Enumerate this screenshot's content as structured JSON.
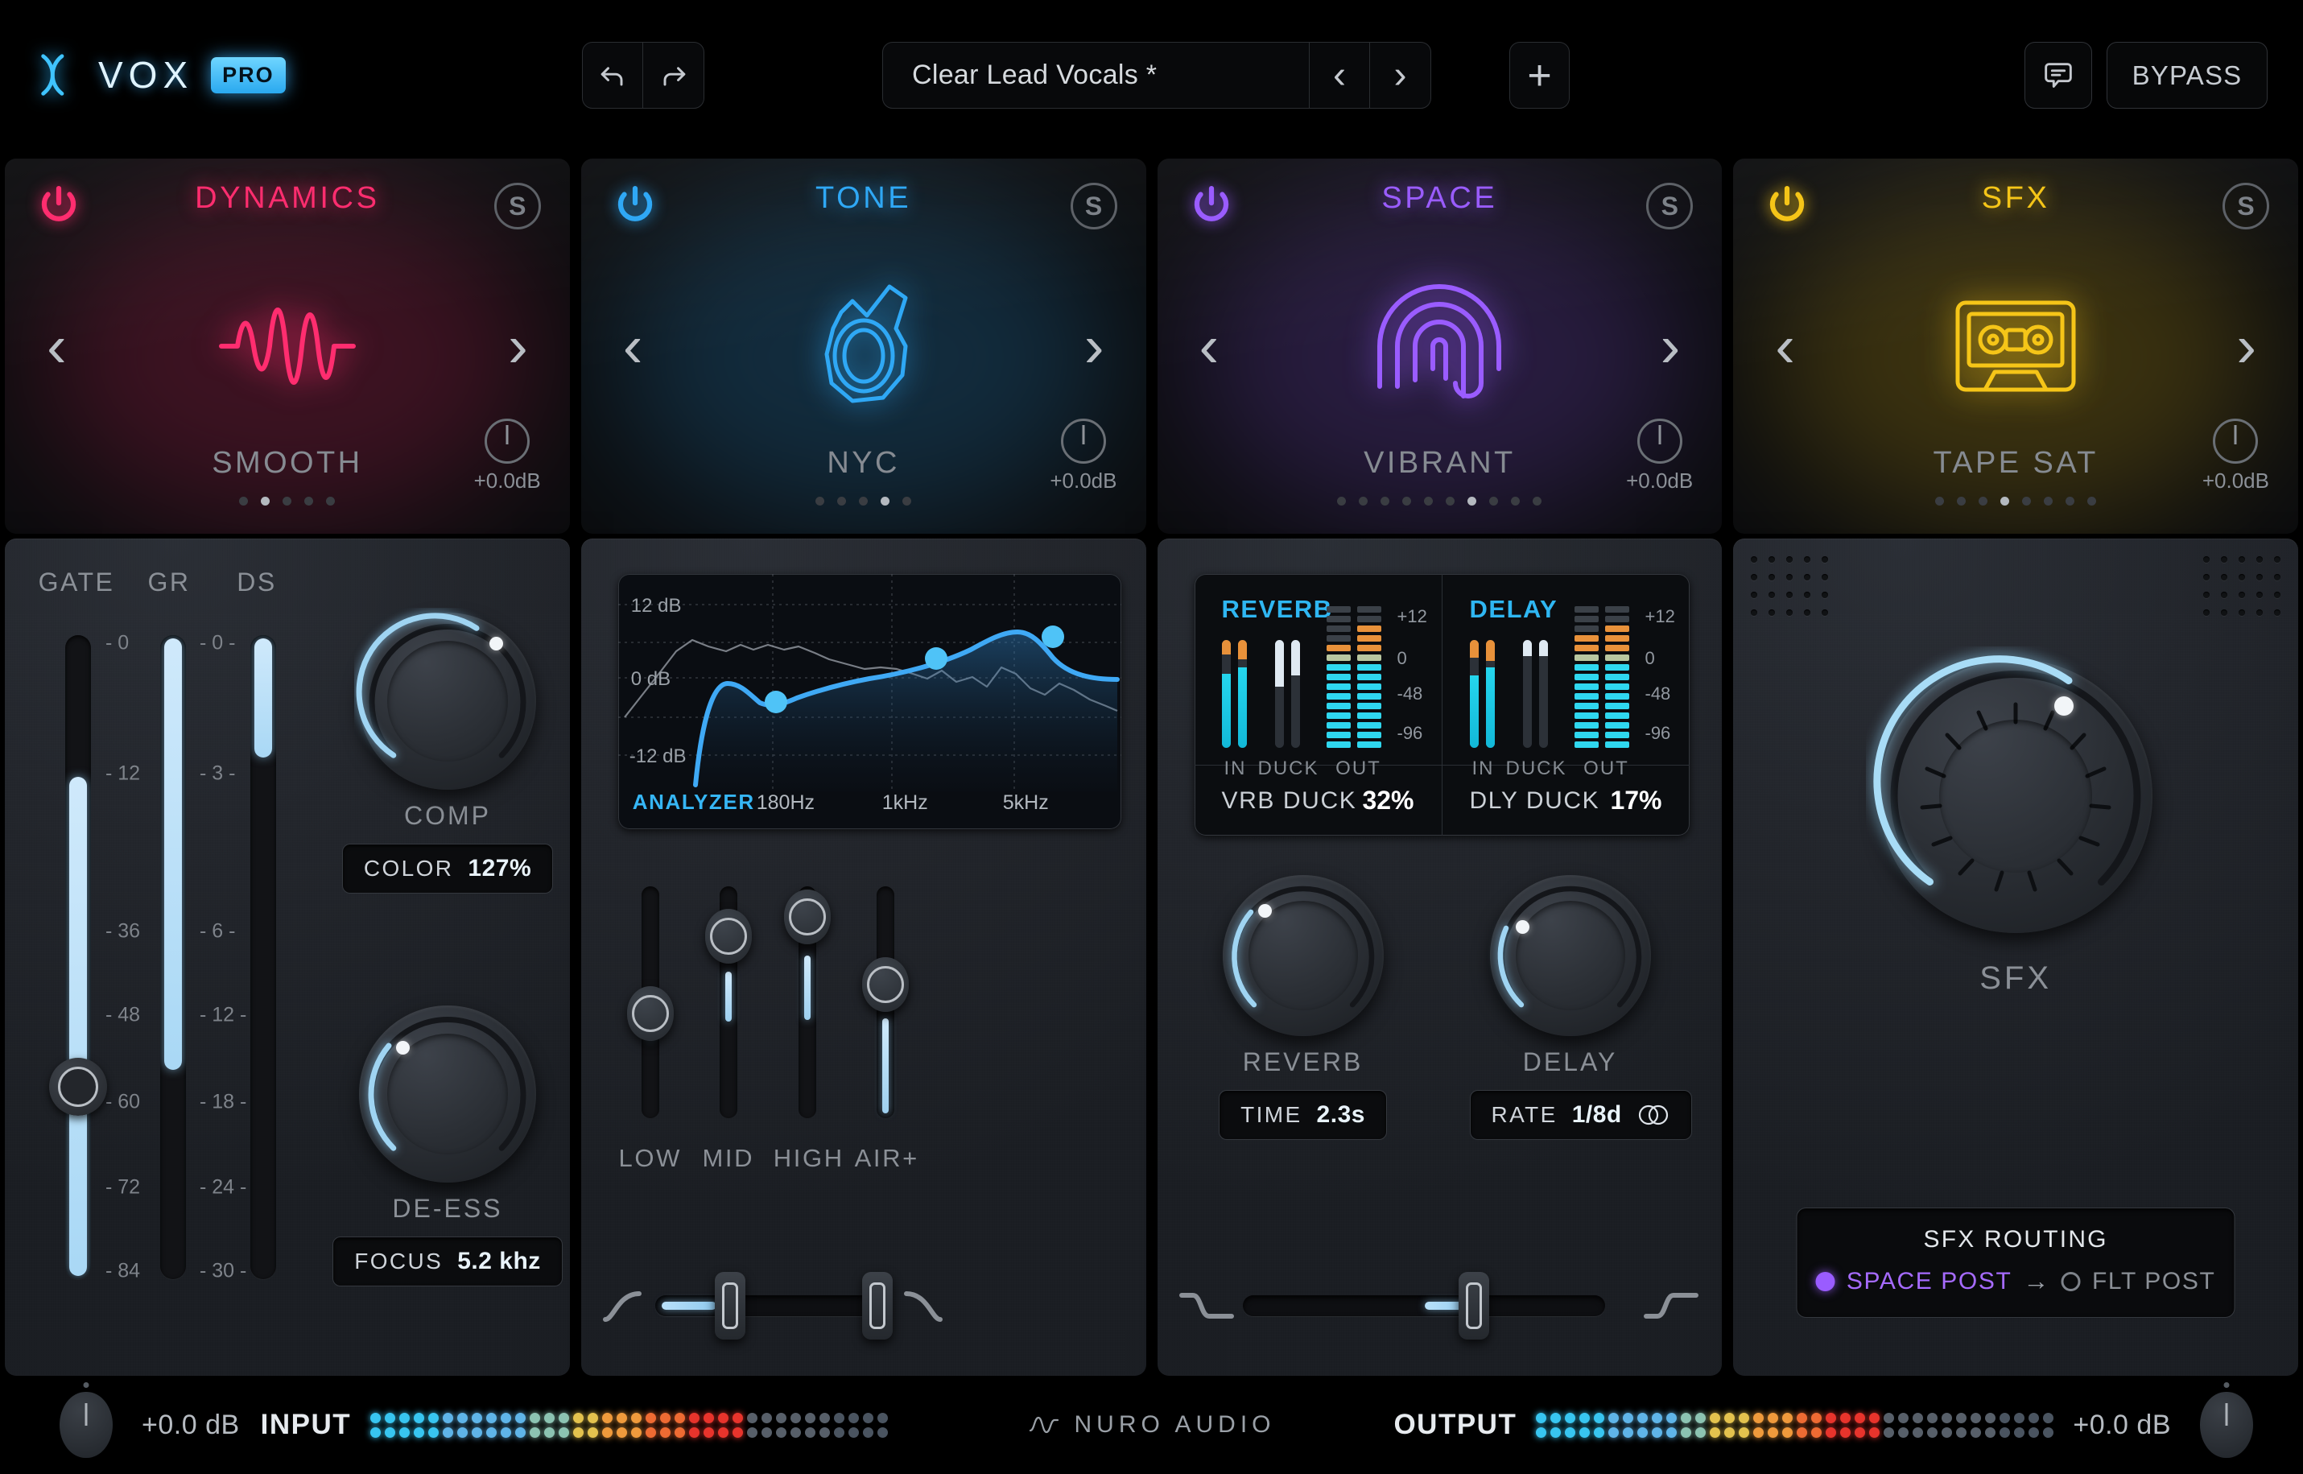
{
  "app": {
    "name": "VOX",
    "badge": "PRO",
    "brand": "NURO AUDIO"
  },
  "toolbar": {
    "undo_icon": "undo-icon",
    "redo_icon": "redo-icon",
    "preset_name": "Clear Lead Vocals *",
    "prev_label": "‹",
    "next_label": "›",
    "add_label": "+",
    "comment_icon": "comment-icon",
    "bypass_label": "BYPASS"
  },
  "modules": [
    {
      "title": "DYNAMICS",
      "color": "#ff2d6f",
      "preset": "SMOOTH",
      "icon": "waveform-icon",
      "solo_label": "S",
      "trim": "+0.0dB",
      "dots": 5,
      "active_dot": 1
    },
    {
      "title": "TONE",
      "color": "#2fa8f5",
      "preset": "NYC",
      "icon": "microphone-icon",
      "solo_label": "S",
      "trim": "+0.0dB",
      "dots": 5,
      "active_dot": 3
    },
    {
      "title": "SPACE",
      "color": "#9a5cff",
      "preset": "VIBRANT",
      "icon": "fingerprint-icon",
      "solo_label": "S",
      "trim": "+0.0dB",
      "dots": 10,
      "active_dot": 6
    },
    {
      "title": "SFX",
      "color": "#f5c518",
      "preset": "TAPE SAT",
      "icon": "cassette-icon",
      "solo_label": "S",
      "trim": "+0.0dB",
      "dots": 8,
      "active_dot": 3
    }
  ],
  "dynamics": {
    "meters": [
      {
        "label": "GATE",
        "ticks": [
          "- 0",
          "- 12",
          "- 36",
          "- 48",
          "- 60",
          "- 72",
          "- 84"
        ],
        "value_pct": 78,
        "handle_pct": 72
      },
      {
        "label": "GR",
        "ticks": [
          "- 0 -",
          "- 3 -",
          "- 6 -",
          "- 12 -",
          "- 18 -",
          "- 24 -",
          "- 30 -"
        ],
        "value_pct": 68
      },
      {
        "label": "DS",
        "ticks": [],
        "value_pct": 22
      }
    ],
    "comp": {
      "label": "COMP",
      "badge_key": "COLOR",
      "badge_value": "127%",
      "value_pct": 72
    },
    "deess": {
      "label": "DE-ESS",
      "badge_key": "FOCUS",
      "badge_value": "5.2 khz",
      "value_pct": 18
    }
  },
  "tone": {
    "analyzer_label": "ANALYZER",
    "db_labels": [
      "12 dB",
      "0 dB",
      "-12 dB"
    ],
    "freq_labels": [
      "180Hz",
      "1kHz",
      "5kHz"
    ],
    "sliders": [
      {
        "label": "LOW",
        "value_pct": 34
      },
      {
        "label": "MID",
        "value_pct": 66
      },
      {
        "label": "HIGH",
        "value_pct": 76
      },
      {
        "label": "AIR+",
        "value_pct": 50
      }
    ],
    "filter": {
      "low_pct": 15,
      "high_pct": 82,
      "left_icon": "highpass-curve-icon",
      "right_icon": "lowpass-curve-icon"
    }
  },
  "chart_data": {
    "type": "line",
    "title": "ANALYZER",
    "xlabel": "",
    "ylabel": "dB",
    "ylim": [
      -18,
      15
    ],
    "yticks": [
      12,
      0,
      -12
    ],
    "ytick_labels": [
      "12 dB",
      "0 dB",
      "-12 dB"
    ],
    "xticks": [
      180,
      1000,
      5000
    ],
    "xtick_labels": [
      "180Hz",
      "1kHz",
      "5kHz"
    ],
    "grid": true,
    "legend": "none",
    "series": [
      {
        "name": "EQ Curve",
        "color": "#46b4f5",
        "x": [
          20,
          40,
          70,
          120,
          180,
          260,
          400,
          700,
          1000,
          1600,
          2500,
          4000,
          5500,
          7000,
          10000,
          16000
        ],
        "y": [
          -17.5,
          -12.0,
          -5.0,
          -2.2,
          -3.8,
          -2.0,
          -0.6,
          0.2,
          0.8,
          1.6,
          3.0,
          5.2,
          6.8,
          5.0,
          2.0,
          0.6
        ]
      },
      {
        "name": "Spectrum",
        "color": "#8d939b",
        "x": [
          20,
          60,
          110,
          170,
          230,
          320,
          450,
          620,
          850,
          1200,
          1700,
          2400,
          3300,
          4500,
          6000,
          8200,
          11000,
          16000
        ],
        "y": [
          -6.5,
          1.0,
          5.8,
          4.2,
          5.0,
          3.6,
          5.0,
          2.2,
          0.5,
          0.8,
          -1.2,
          1.0,
          -2.2,
          2.4,
          -3.5,
          -1.0,
          -4.5,
          -4.0
        ]
      }
    ],
    "points": [
      {
        "label": "LOW NODE",
        "x": 180,
        "y": -3.8,
        "color": "#46b4f5"
      },
      {
        "label": "MID NODE",
        "x": 2200,
        "y": 5.2,
        "color": "#46b4f5"
      },
      {
        "label": "HIGH NODE",
        "x": 5200,
        "y": 8.5,
        "color": "#46b4f5"
      }
    ]
  },
  "space": {
    "reverb": {
      "title": "REVERB",
      "meter_labels": [
        "IN",
        "DUCK",
        "OUT"
      ],
      "scale": [
        "+12",
        "0",
        "-48",
        "-96"
      ],
      "duck_key": "VRB DUCK",
      "duck_value": "32%",
      "knob_label": "REVERB",
      "knob_pct": 18,
      "badge_key": "TIME",
      "badge_value": "2.3s"
    },
    "delay": {
      "title": "DELAY",
      "meter_labels": [
        "IN",
        "DUCK",
        "OUT"
      ],
      "scale": [
        "+12",
        "0",
        "-48",
        "-96"
      ],
      "duck_key": "DLY DUCK",
      "duck_value": "17%",
      "knob_label": "DELAY",
      "knob_pct": 12,
      "badge_key": "RATE",
      "badge_value": "1/8d",
      "link_icon": "link-circles-icon"
    },
    "tilt": {
      "value_pct": 55,
      "left_icon": "shelf-down-icon",
      "right_icon": "shelf-up-icon"
    }
  },
  "sfx": {
    "knob_label": "SFX",
    "knob_pct": 66,
    "routing_title": "SFX ROUTING",
    "routing_active": "SPACE POST",
    "routing_arrow": "→",
    "routing_inactive": "FLT POST"
  },
  "footer": {
    "input_value": "+0.0 dB",
    "input_label": "INPUT",
    "output_label": "OUTPUT",
    "output_value": "+0.0 dB",
    "input_lit": 26,
    "input_total": 36,
    "output_lit": 24,
    "output_total": 36
  }
}
